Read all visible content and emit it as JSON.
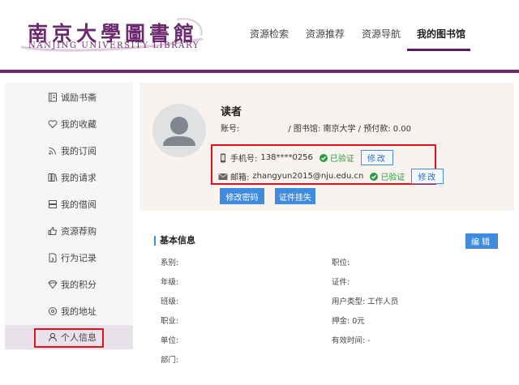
{
  "header": {
    "logo_cn": "南京大學圖書館",
    "logo_en": "NANJING UNIVERSITY LIBRARY",
    "nav": [
      "资源检索",
      "资源推荐",
      "资源导航",
      "我的图书馆"
    ],
    "active_nav": "我的图书馆",
    "accent_color": "#6d2a6e"
  },
  "sidebar": {
    "items": [
      {
        "label": "诚励书斋",
        "icon": "book-icon"
      },
      {
        "label": "我的收藏",
        "icon": "heart-icon"
      },
      {
        "label": "我的订阅",
        "icon": "rss-icon"
      },
      {
        "label": "我的请求",
        "icon": "books-icon"
      },
      {
        "label": "我的借阅",
        "icon": "stack-icon"
      },
      {
        "label": "资源荐购",
        "icon": "thumbs-up-icon"
      },
      {
        "label": "行为记录",
        "icon": "record-icon"
      },
      {
        "label": "我的积分",
        "icon": "diamond-icon"
      },
      {
        "label": "我的地址",
        "icon": "location-icon"
      },
      {
        "label": "个人信息",
        "icon": "user-icon"
      }
    ],
    "active_item": "个人信息"
  },
  "profile": {
    "name": "读者",
    "account_label": "账号:",
    "library_text": "/ 图书馆: 南京大学 / 预付款: 0.00",
    "phone_label": "手机号:",
    "phone_value": "138****0256",
    "email_label": "邮箱:",
    "email_value": "zhangyun2015@nju.edu.cn",
    "verified_text": "已验证",
    "modify_label": "修改",
    "change_password_label": "修改密码",
    "report_loss_label": "证件挂失"
  },
  "basic_info": {
    "title": "基本信息",
    "edit_label": "编辑",
    "left_fields": [
      "系别:",
      "年级:",
      "班级:",
      "职业:",
      "单位:",
      "部门:"
    ],
    "right_fields": [
      "职位:",
      "证件:",
      "用户类型: 工作人员",
      "押金: 0元",
      "有效时间: -"
    ]
  }
}
